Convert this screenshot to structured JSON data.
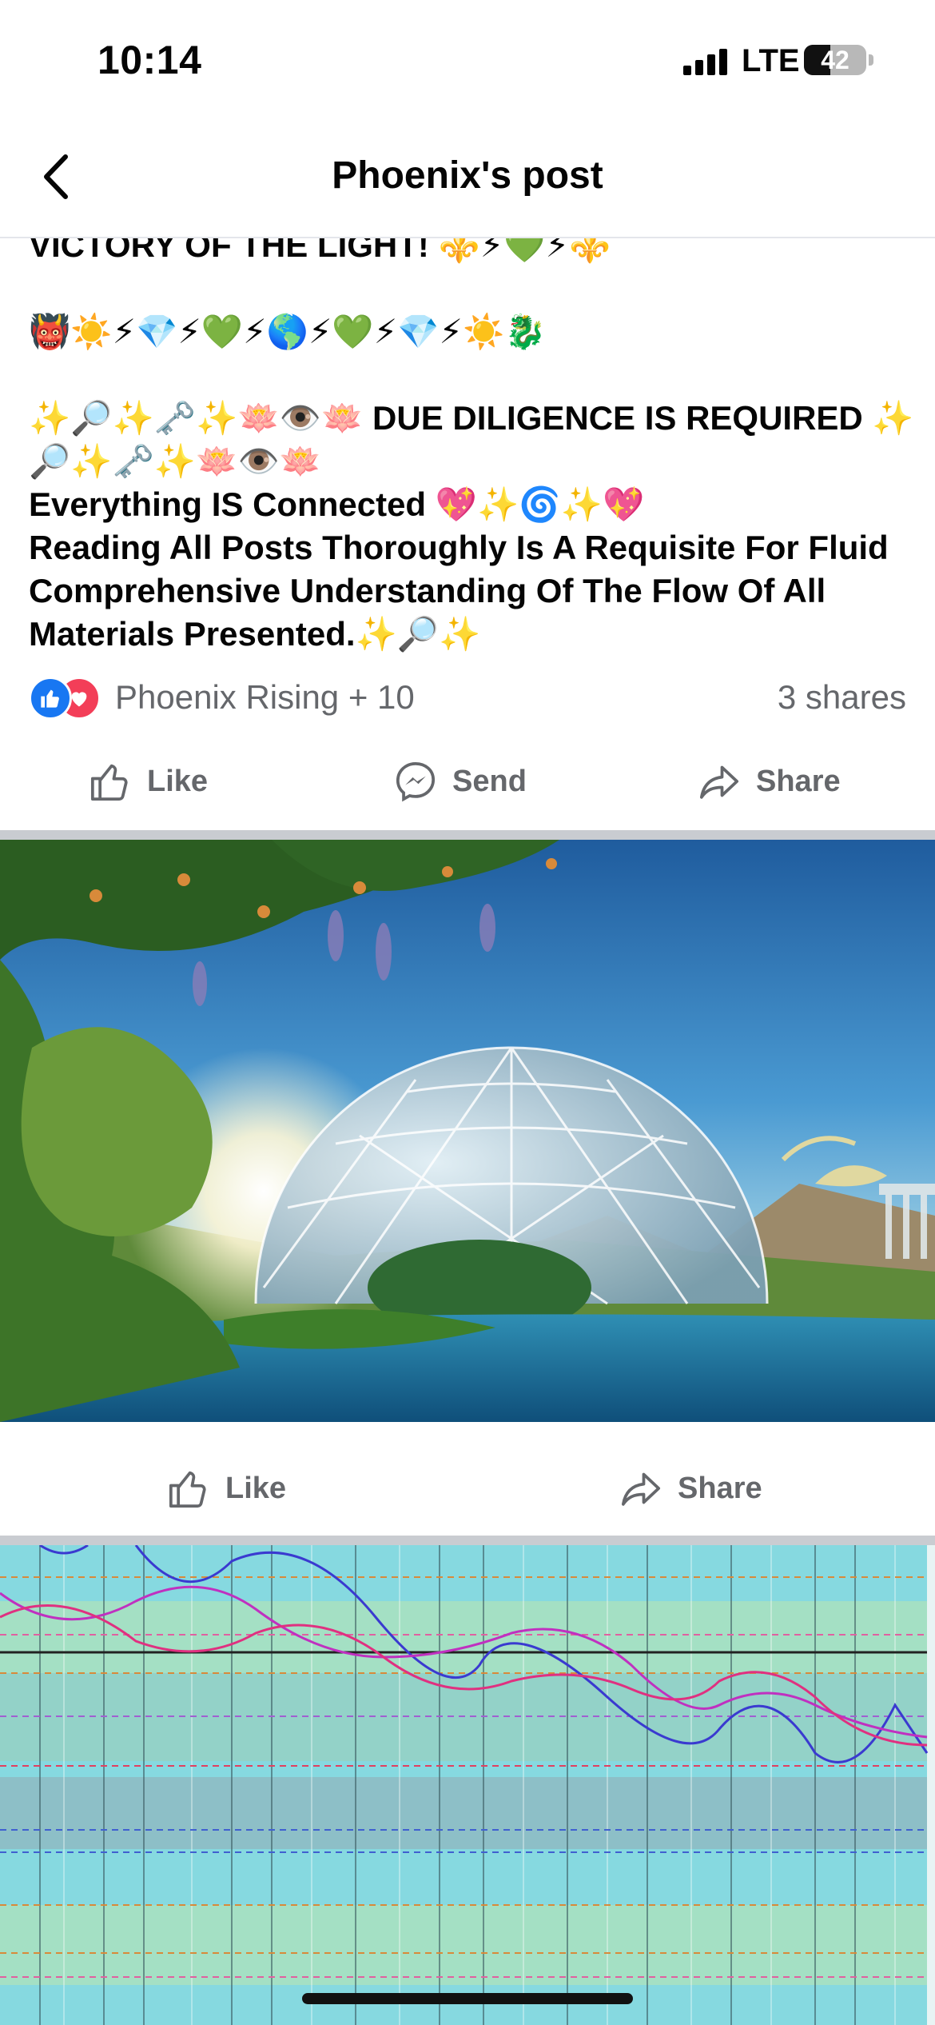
{
  "status": {
    "time": "10:14",
    "network": "LTE",
    "battery": "42",
    "battery_level": 0.42
  },
  "header": {
    "title": "Phoenix's post"
  },
  "post": {
    "lines": [
      "VICTORY OF THE LIGHT! ⚜️⚡💚⚡⚜️",
      "👹☀️⚡💎⚡💚⚡🌎⚡💚⚡💎⚡☀️🐉",
      "✨🔎✨🗝️✨🪷👁️🪷 DUE DILIGENCE IS REQUIRED ✨🔎✨🗝️✨🪷👁️🪷",
      "Everything IS Connected 💖✨🌀✨💖",
      "Reading All Posts Thoroughly Is A Requisite For Fluid Comprehensive Understanding Of The Flow Of All Materials Presented.✨🔎✨"
    ]
  },
  "reactions": {
    "names": "Phoenix Rising + 10",
    "shares": "3 shares"
  },
  "actions_top": {
    "like": "Like",
    "send": "Send",
    "share": "Share"
  },
  "actions_image": {
    "like": "Like",
    "share": "Share"
  },
  "colors": {
    "text": "#050505",
    "muted": "#65676b",
    "like_blue": "#1877f2",
    "love_red": "#f33e58"
  },
  "icons": [
    "back-chevron-icon",
    "like-thumb-icon",
    "messenger-icon",
    "share-arrow-icon",
    "love-heart-icon"
  ]
}
